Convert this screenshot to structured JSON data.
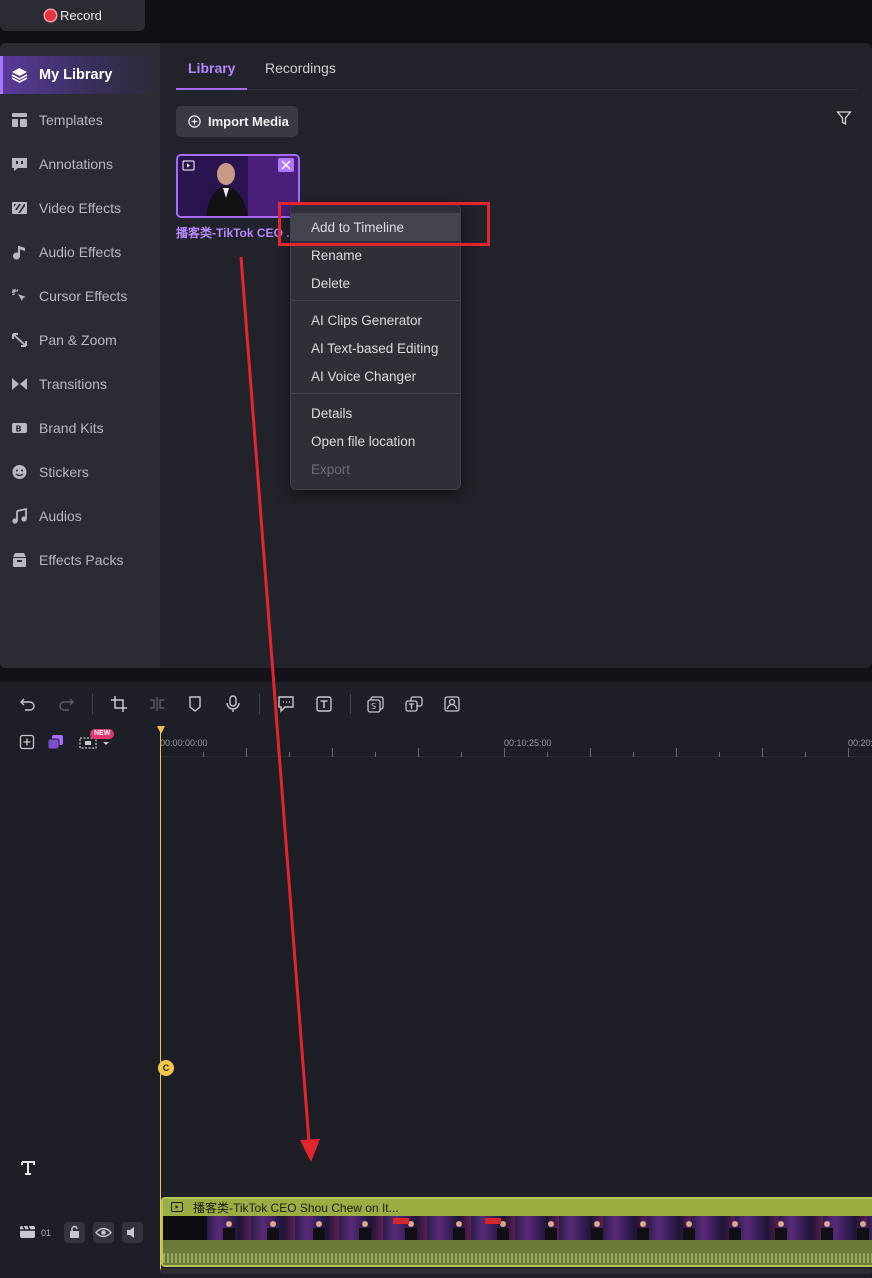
{
  "topbar": {
    "record_label": "Record"
  },
  "sidebar": {
    "items": [
      {
        "label": "My Library",
        "icon": "layers-icon",
        "active": true
      },
      {
        "label": "Templates",
        "icon": "template-icon"
      },
      {
        "label": "Annotations",
        "icon": "annotation-icon"
      },
      {
        "label": "Video Effects",
        "icon": "video-effects-icon"
      },
      {
        "label": "Audio Effects",
        "icon": "audio-effects-icon"
      },
      {
        "label": "Cursor Effects",
        "icon": "cursor-effects-icon"
      },
      {
        "label": "Pan & Zoom",
        "icon": "pan-zoom-icon"
      },
      {
        "label": "Transitions",
        "icon": "transitions-icon"
      },
      {
        "label": "Brand Kits",
        "icon": "brand-kit-icon"
      },
      {
        "label": "Stickers",
        "icon": "sticker-icon"
      },
      {
        "label": "Audios",
        "icon": "music-note-icon"
      },
      {
        "label": "Effects Packs",
        "icon": "effects-pack-icon"
      }
    ]
  },
  "library": {
    "tabs": [
      "Library",
      "Recordings"
    ],
    "import_label": "Import Media",
    "media": {
      "caption": "播客类-TikTok CEO ..."
    }
  },
  "context_menu": {
    "items": [
      {
        "label": "Add to Timeline",
        "state": "hover"
      },
      {
        "label": "Rename"
      },
      {
        "label": "Delete"
      },
      {
        "label": "AI Clips Generator"
      },
      {
        "label": "AI Text-based Editing"
      },
      {
        "label": "AI Voice Changer"
      },
      {
        "label": "Details"
      },
      {
        "label": "Open file location"
      },
      {
        "label": "Export",
        "state": "disabled"
      }
    ]
  },
  "timeline": {
    "ruler_labels": [
      "00:00:00:00",
      "00:10:25:00",
      "00:20:"
    ],
    "new_badge": "NEW",
    "track_number": "01",
    "playhead_marker": "C",
    "clip_title": "播客类-TikTok CEO Shou Chew on It..."
  },
  "colors": {
    "accent": "#a66dff",
    "highlight": "#e4252e",
    "playhead": "#f2c54b",
    "clip": "#9aae42"
  }
}
